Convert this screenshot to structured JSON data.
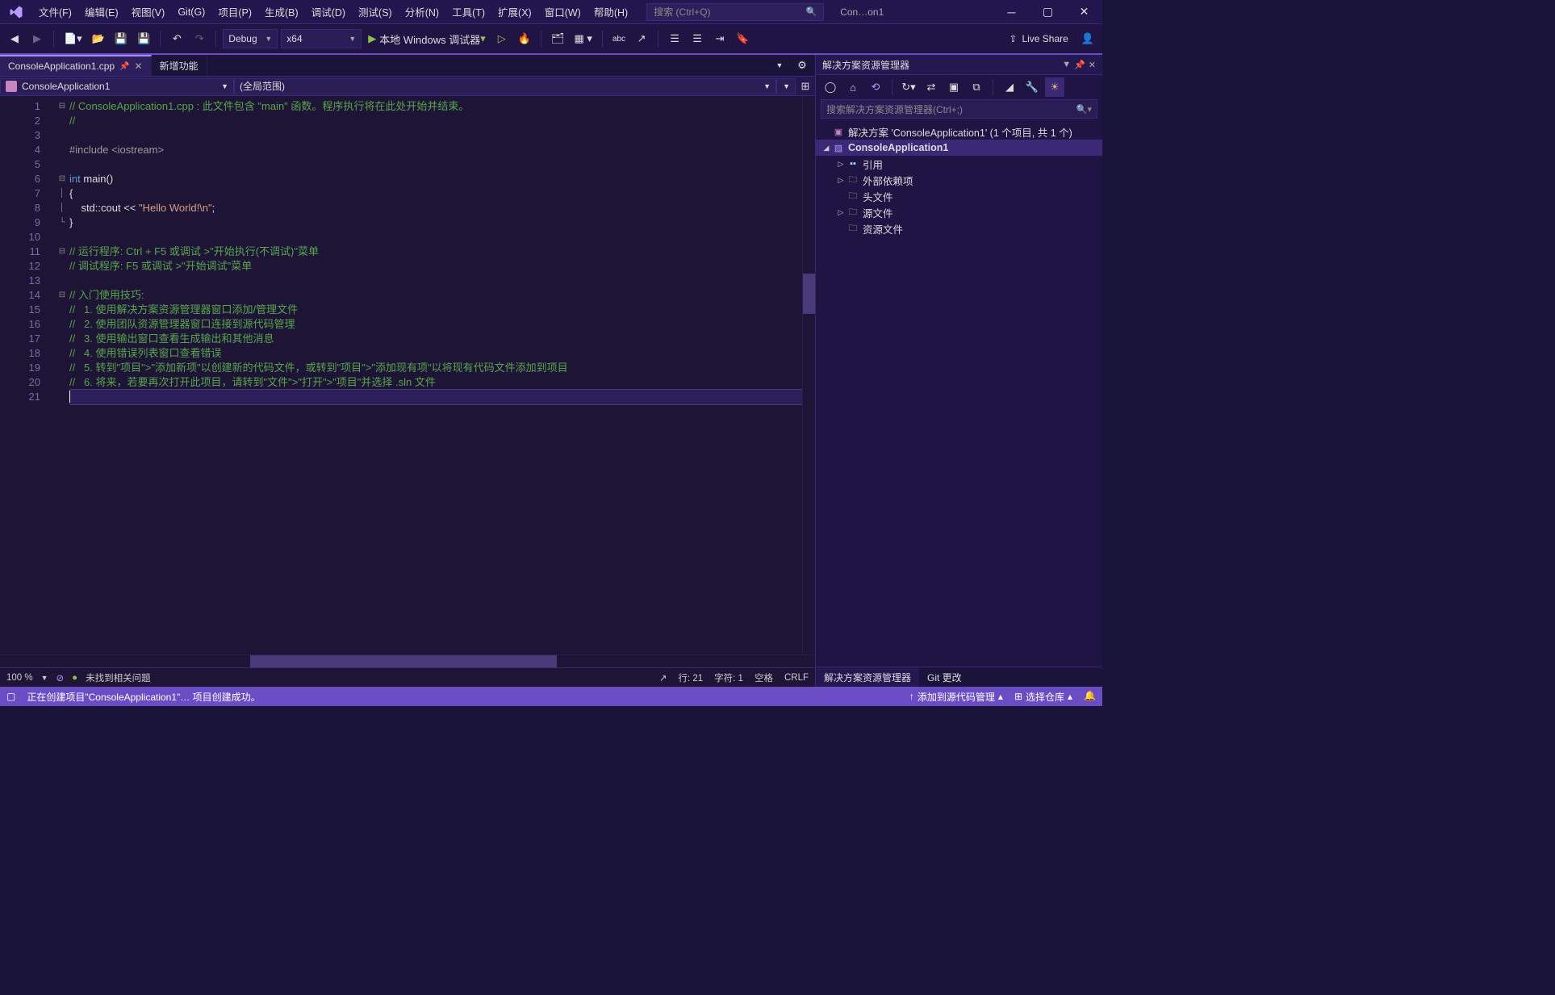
{
  "title": "Con…on1",
  "menu": [
    "文件(F)",
    "编辑(E)",
    "视图(V)",
    "Git(G)",
    "项目(P)",
    "生成(B)",
    "调试(D)",
    "测试(S)",
    "分析(N)",
    "工具(T)",
    "扩展(X)",
    "窗口(W)",
    "帮助(H)"
  ],
  "searchPlaceholder": "搜索 (Ctrl+Q)",
  "toolbar": {
    "config": "Debug",
    "platform": "x64",
    "debugTarget": "本地 Windows 调试器",
    "liveShare": "Live Share"
  },
  "tabs": [
    {
      "label": "ConsoleApplication1.cpp",
      "active": true,
      "pinned": true
    },
    {
      "label": "新增功能",
      "active": false
    }
  ],
  "breadcrumb": {
    "project": "ConsoleApplication1",
    "scope": "(全局范围)"
  },
  "code": {
    "lines": 21,
    "raw": [
      {
        "c": "comment",
        "t": "// ConsoleApplication1.cpp : 此文件包含 \"main\" 函数。程序执行将在此处开始并结束。"
      },
      {
        "c": "comment",
        "t": "//"
      },
      {
        "c": "",
        "t": ""
      },
      {
        "c": "pp",
        "t": "#include <iostream>"
      },
      {
        "c": "",
        "t": ""
      },
      {
        "mix": [
          {
            "c": "kw",
            "t": "int"
          },
          {
            "c": "",
            "t": " main()"
          }
        ]
      },
      {
        "c": "",
        "t": "{"
      },
      {
        "mix": [
          {
            "c": "",
            "t": "    std::cout << "
          },
          {
            "c": "str",
            "t": "\"Hello World!\\n\""
          },
          {
            "c": "",
            "t": ";"
          }
        ]
      },
      {
        "c": "",
        "t": "}"
      },
      {
        "c": "",
        "t": ""
      },
      {
        "c": "comment",
        "t": "// 运行程序: Ctrl + F5 或调试 >\"开始执行(不调试)\"菜单"
      },
      {
        "c": "comment",
        "t": "// 调试程序: F5 或调试 >\"开始调试\"菜单"
      },
      {
        "c": "",
        "t": ""
      },
      {
        "c": "comment",
        "t": "// 入门使用技巧:"
      },
      {
        "c": "comment",
        "t": "//   1. 使用解决方案资源管理器窗口添加/管理文件"
      },
      {
        "c": "comment",
        "t": "//   2. 使用团队资源管理器窗口连接到源代码管理"
      },
      {
        "c": "comment",
        "t": "//   3. 使用输出窗口查看生成输出和其他消息"
      },
      {
        "c": "comment",
        "t": "//   4. 使用错误列表窗口查看错误"
      },
      {
        "c": "comment",
        "t": "//   5. 转到\"项目\">\"添加新项\"以创建新的代码文件，或转到\"项目\">\"添加现有项\"以将现有代码文件添加到项目"
      },
      {
        "c": "comment",
        "t": "//   6. 将来，若要再次打开此项目，请转到\"文件\">\"打开\">\"项目\"并选择 .sln 文件"
      },
      {
        "c": "",
        "t": ""
      }
    ]
  },
  "editorStatus": {
    "zoom": "100 %",
    "noIssues": "未找到相关问题",
    "line": "行: 21",
    "col": "字符: 1",
    "ins": "空格",
    "eol": "CRLF"
  },
  "solutionExplorer": {
    "title": "解决方案资源管理器",
    "searchPlaceholder": "搜索解决方案资源管理器(Ctrl+;)",
    "solution": "解决方案 'ConsoleApplication1' (1 个项目, 共 1 个)",
    "project": "ConsoleApplication1",
    "nodes": [
      "引用",
      "外部依赖项",
      "头文件",
      "源文件",
      "资源文件"
    ]
  },
  "panelTabs": [
    "解决方案资源管理器",
    "Git 更改"
  ],
  "statusbar": {
    "message": "正在创建项目\"ConsoleApplication1\"… 项目创建成功。",
    "addSource": "添加到源代码管理",
    "selectRepo": "选择仓库"
  }
}
